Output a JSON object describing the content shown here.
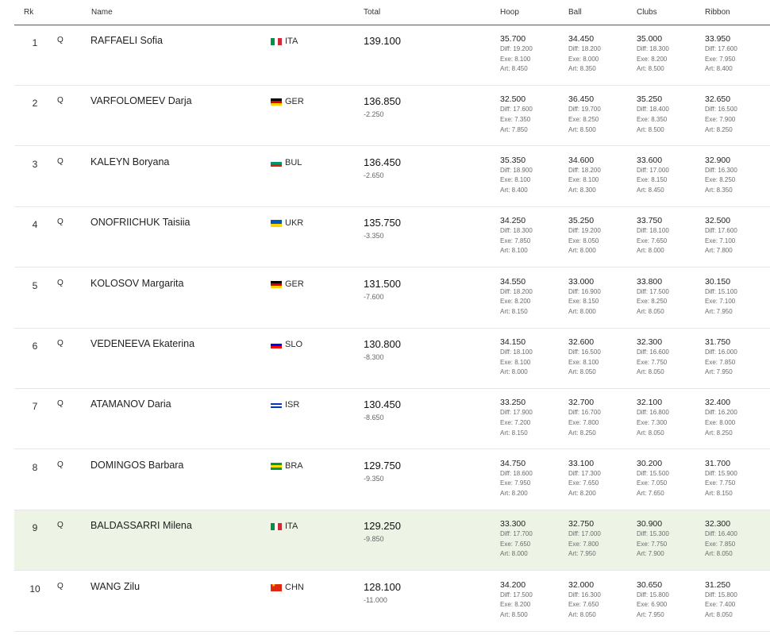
{
  "header": {
    "rank": "Rk",
    "name": "Name",
    "total": "Total",
    "hoop": "Hoop",
    "ball": "Ball",
    "clubs": "Clubs",
    "ribbon": "Ribbon"
  },
  "labels": {
    "diff": "Diff: ",
    "exe": "Exe: ",
    "art": "Art: "
  },
  "rows": [
    {
      "rank": "1",
      "q": "Q",
      "name": "RAFFAELI Sofia",
      "noc": "ITA",
      "flag": "ITA",
      "total": "139.100",
      "gap": "",
      "hoop": {
        "score": "35.700",
        "diff": "19.200",
        "exe": "8.100",
        "art": "8.450"
      },
      "ball": {
        "score": "34.450",
        "diff": "18.200",
        "exe": "8.000",
        "art": "8.350"
      },
      "clubs": {
        "score": "35.000",
        "diff": "18.300",
        "exe": "8.200",
        "art": "8.500"
      },
      "ribbon": {
        "score": "33.950",
        "diff": "17.600",
        "exe": "7.950",
        "art": "8.400"
      }
    },
    {
      "rank": "2",
      "q": "Q",
      "name": "VARFOLOMEEV Darja",
      "noc": "GER",
      "flag": "GER",
      "total": "136.850",
      "gap": "-2.250",
      "hoop": {
        "score": "32.500",
        "diff": "17.600",
        "exe": "7.350",
        "art": "7.850"
      },
      "ball": {
        "score": "36.450",
        "diff": "19.700",
        "exe": "8.250",
        "art": "8.500"
      },
      "clubs": {
        "score": "35.250",
        "diff": "18.400",
        "exe": "8.350",
        "art": "8.500"
      },
      "ribbon": {
        "score": "32.650",
        "diff": "16.500",
        "exe": "7.900",
        "art": "8.250"
      }
    },
    {
      "rank": "3",
      "q": "Q",
      "name": "KALEYN Boryana",
      "noc": "BUL",
      "flag": "BUL",
      "total": "136.450",
      "gap": "-2.650",
      "hoop": {
        "score": "35.350",
        "diff": "18.900",
        "exe": "8.100",
        "art": "8.400"
      },
      "ball": {
        "score": "34.600",
        "diff": "18.200",
        "exe": "8.100",
        "art": "8.300"
      },
      "clubs": {
        "score": "33.600",
        "diff": "17.000",
        "exe": "8.150",
        "art": "8.450"
      },
      "ribbon": {
        "score": "32.900",
        "diff": "16.300",
        "exe": "8.250",
        "art": "8.350"
      }
    },
    {
      "rank": "4",
      "q": "Q",
      "name": "ONOFRIICHUK Taisiia",
      "noc": "UKR",
      "flag": "UKR",
      "total": "135.750",
      "gap": "-3.350",
      "hoop": {
        "score": "34.250",
        "diff": "18.300",
        "exe": "7.850",
        "art": "8.100"
      },
      "ball": {
        "score": "35.250",
        "diff": "19.200",
        "exe": "8.050",
        "art": "8.000"
      },
      "clubs": {
        "score": "33.750",
        "diff": "18.100",
        "exe": "7.650",
        "art": "8.000"
      },
      "ribbon": {
        "score": "32.500",
        "diff": "17.600",
        "exe": "7.100",
        "art": "7.800"
      }
    },
    {
      "rank": "5",
      "q": "Q",
      "name": "KOLOSOV Margarita",
      "noc": "GER",
      "flag": "GER",
      "total": "131.500",
      "gap": "-7.600",
      "hoop": {
        "score": "34.550",
        "diff": "18.200",
        "exe": "8.200",
        "art": "8.150"
      },
      "ball": {
        "score": "33.000",
        "diff": "16.900",
        "exe": "8.150",
        "art": "8.000"
      },
      "clubs": {
        "score": "33.800",
        "diff": "17.500",
        "exe": "8.250",
        "art": "8.050"
      },
      "ribbon": {
        "score": "30.150",
        "diff": "15.100",
        "exe": "7.100",
        "art": "7.950"
      }
    },
    {
      "rank": "6",
      "q": "Q",
      "name": "VEDENEEVA Ekaterina",
      "noc": "SLO",
      "flag": "SLO",
      "total": "130.800",
      "gap": "-8.300",
      "hoop": {
        "score": "34.150",
        "diff": "18.100",
        "exe": "8.100",
        "art": "8.000"
      },
      "ball": {
        "score": "32.600",
        "diff": "16.500",
        "exe": "8.100",
        "art": "8.050"
      },
      "clubs": {
        "score": "32.300",
        "diff": "16.600",
        "exe": "7.750",
        "art": "8.050"
      },
      "ribbon": {
        "score": "31.750",
        "diff": "16.000",
        "exe": "7.850",
        "art": "7.950"
      }
    },
    {
      "rank": "7",
      "q": "Q",
      "name": "ATAMANOV Daria",
      "noc": "ISR",
      "flag": "ISR",
      "total": "130.450",
      "gap": "-8.650",
      "hoop": {
        "score": "33.250",
        "diff": "17.900",
        "exe": "7.200",
        "art": "8.150"
      },
      "ball": {
        "score": "32.700",
        "diff": "16.700",
        "exe": "7.800",
        "art": "8.250"
      },
      "clubs": {
        "score": "32.100",
        "diff": "16.800",
        "exe": "7.300",
        "art": "8.050"
      },
      "ribbon": {
        "score": "32.400",
        "diff": "16.200",
        "exe": "8.000",
        "art": "8.250"
      }
    },
    {
      "rank": "8",
      "q": "Q",
      "name": "DOMINGOS Barbara",
      "noc": "BRA",
      "flag": "BRA",
      "total": "129.750",
      "gap": "-9.350",
      "hoop": {
        "score": "34.750",
        "diff": "18.600",
        "exe": "7.950",
        "art": "8.200"
      },
      "ball": {
        "score": "33.100",
        "diff": "17.300",
        "exe": "7.650",
        "art": "8.200"
      },
      "clubs": {
        "score": "30.200",
        "diff": "15.500",
        "exe": "7.050",
        "art": "7.650"
      },
      "ribbon": {
        "score": "31.700",
        "diff": "15.900",
        "exe": "7.750",
        "art": "8.150"
      }
    },
    {
      "rank": "9",
      "q": "Q",
      "name": "BALDASSARRI Milena",
      "noc": "ITA",
      "flag": "ITA",
      "total": "129.250",
      "gap": "-9.850",
      "highlight": true,
      "hoop": {
        "score": "33.300",
        "diff": "17.700",
        "exe": "7.650",
        "art": "8.000"
      },
      "ball": {
        "score": "32.750",
        "diff": "17.000",
        "exe": "7.800",
        "art": "7.950"
      },
      "clubs": {
        "score": "30.900",
        "diff": "15.300",
        "exe": "7.750",
        "art": "7.900"
      },
      "ribbon": {
        "score": "32.300",
        "diff": "16.400",
        "exe": "7.850",
        "art": "8.050"
      }
    },
    {
      "rank": "10",
      "q": "Q",
      "name": "WANG Zilu",
      "noc": "CHN",
      "flag": "CHN",
      "total": "128.100",
      "gap": "-11.000",
      "hoop": {
        "score": "34.200",
        "diff": "17.500",
        "exe": "8.200",
        "art": "8.500"
      },
      "ball": {
        "score": "32.000",
        "diff": "16.300",
        "exe": "7.650",
        "art": "8.050"
      },
      "clubs": {
        "score": "30.650",
        "diff": "15.800",
        "exe": "6.900",
        "art": "7.950"
      },
      "ribbon": {
        "score": "31.250",
        "diff": "15.800",
        "exe": "7.400",
        "art": "8.050"
      }
    }
  ],
  "flags": {
    "ITA": {
      "dir": "v",
      "colors": [
        "#009246",
        "#ffffff",
        "#ce2b37"
      ]
    },
    "GER": {
      "dir": "h",
      "colors": [
        "#000000",
        "#dd0000",
        "#ffce00"
      ]
    },
    "BUL": {
      "dir": "h",
      "colors": [
        "#ffffff",
        "#00966e",
        "#d62612"
      ]
    },
    "UKR": {
      "dir": "h",
      "colors": [
        "#0057b7",
        "#ffd700"
      ]
    },
    "SLO": {
      "dir": "h",
      "colors": [
        "#ffffff",
        "#0000ff",
        "#ff0000"
      ]
    },
    "ISR": {
      "dir": "h",
      "colors": [
        "#ffffff",
        "#0038b8",
        "#ffffff",
        "#0038b8",
        "#ffffff"
      ]
    },
    "BRA": {
      "dir": "h",
      "colors": [
        "#009c3b",
        "#ffdf00",
        "#009c3b"
      ]
    },
    "CHN": {
      "dir": "h",
      "colors": [
        "#de2910"
      ]
    }
  },
  "colors": {
    "header_rule": "#2c5fa0",
    "highlight_row": "#edf4e5"
  }
}
